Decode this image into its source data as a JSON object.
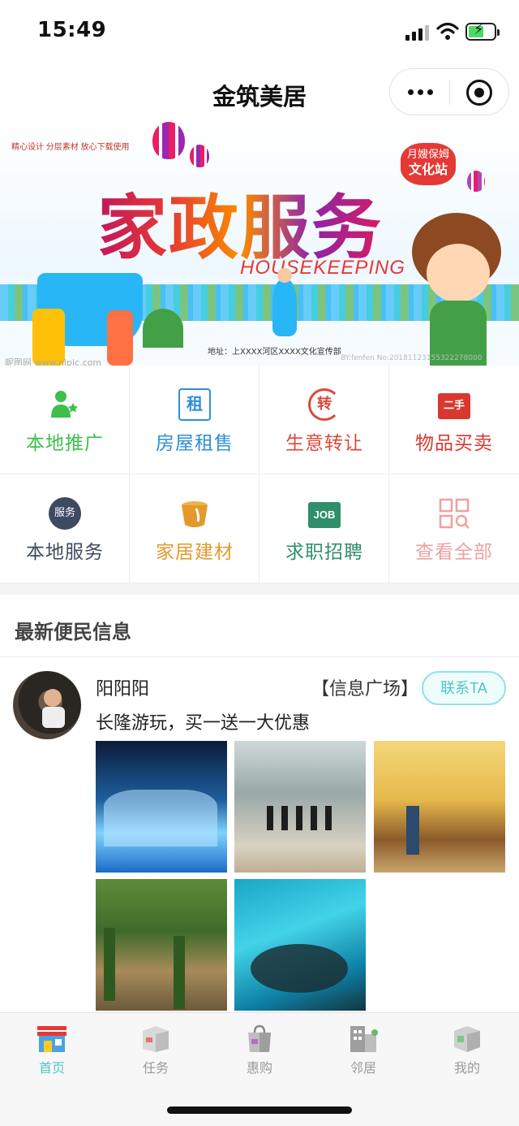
{
  "status_bar": {
    "time": "15:49"
  },
  "nav": {
    "title": "金筑美居"
  },
  "banner": {
    "top_note": "精心设计 分层素材 放心下载使用",
    "headline": "家政服务",
    "english": "HOUSEKEEPING",
    "badge_line1": "月嫂保姆",
    "badge_line2": "文化站",
    "address": "地址：上XXXX河区XXXX文化宣传部",
    "watermark_left": "昵图网 www.nipic.com",
    "watermark_right": "BY:fenfen No:20181123155322278000"
  },
  "categories": [
    {
      "label": "本地推广",
      "color": "#3fbf4a",
      "icon": "promote-icon"
    },
    {
      "label": "房屋租售",
      "color": "#2f8fd8",
      "icon": "rent-icon"
    },
    {
      "label": "生意转让",
      "color": "#d84a3a",
      "icon": "transfer-icon"
    },
    {
      "label": "物品买卖",
      "color": "#d8382f",
      "icon": "secondhand-icon"
    },
    {
      "label": "本地服务",
      "color": "#3e4a60",
      "icon": "service-icon"
    },
    {
      "label": "家居建材",
      "color": "#e39a2b",
      "icon": "paint-bucket-icon"
    },
    {
      "label": "求职招聘",
      "color": "#2f8f6a",
      "icon": "job-icon"
    },
    {
      "label": "查看全部",
      "color": "#f0a0a0",
      "icon": "view-all-icon"
    }
  ],
  "icon_texts": {
    "rent": "租",
    "transfer": "转",
    "secondhand": "二手",
    "service": "服务",
    "job": "JOB"
  },
  "section": {
    "title": "最新便民信息"
  },
  "post": {
    "user": "阳阳阳",
    "tag": "【信息广场】",
    "contact": "联系TA",
    "text": "长隆游玩，买一送一大优惠",
    "photo_count": 5
  },
  "tabs": [
    {
      "label": "首页",
      "icon": "home-store-icon",
      "active": true
    },
    {
      "label": "任务",
      "icon": "task-box-icon",
      "active": false
    },
    {
      "label": "惠购",
      "icon": "shopping-bag-icon",
      "active": false
    },
    {
      "label": "邻居",
      "icon": "neighbor-building-icon",
      "active": false
    },
    {
      "label": "我的",
      "icon": "profile-cube-icon",
      "active": false
    }
  ],
  "colors": {
    "accent": "#4cc7c4",
    "tab_inactive": "#9a9a9a"
  }
}
